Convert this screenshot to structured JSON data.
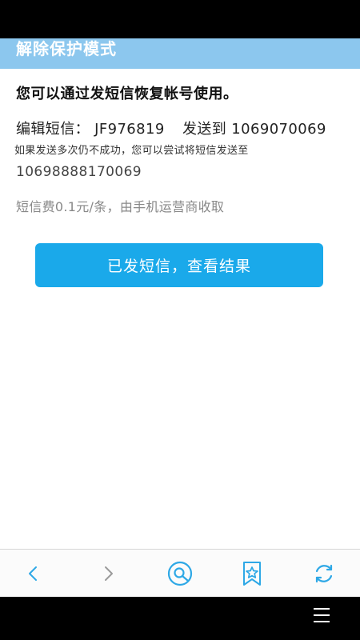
{
  "header": {
    "title": "解除保护模式"
  },
  "content": {
    "intro": "您可以通过发短信恢复帐号使用。",
    "sms_label": "编辑短信：",
    "sms_code": "JF976819",
    "send_to_text": "发送到",
    "primary_number": "1069070069",
    "fallback_text": "如果发送多次仍不成功，您可以尝试将短信发送至",
    "fallback_number": "10698888170069",
    "fee_text": "短信费0.1元/条，由手机运营商收取",
    "action_label": "已发短信，查看结果"
  },
  "toolbar": {
    "back_icon": "chevron-left-icon",
    "forward_icon": "chevron-right-icon",
    "home_icon": "search-home-icon",
    "bookmark_icon": "bookmark-star-icon",
    "refresh_icon": "refresh-icon"
  },
  "colors": {
    "header_bg": "#8cc7ee",
    "button_bg": "#1aa9ea",
    "toolbar_icon": "#2ea8e6"
  }
}
